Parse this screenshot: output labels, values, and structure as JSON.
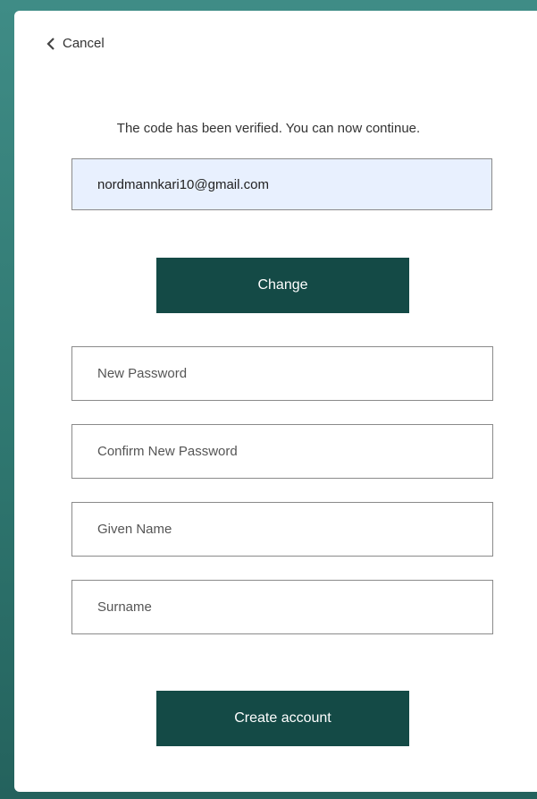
{
  "nav": {
    "cancel_label": "Cancel",
    "cancel_icon": "chevron-left-icon"
  },
  "verification": {
    "message": "The code has been verified. You can now continue.",
    "email_value": "nordmannkari10@gmail.com",
    "change_label": "Change"
  },
  "form": {
    "new_password_placeholder": "New Password",
    "confirm_password_placeholder": "Confirm New Password",
    "given_name_placeholder": "Given Name",
    "surname_placeholder": "Surname",
    "create_label": "Create account"
  },
  "colors": {
    "button_bg": "#144a46",
    "frame_teal": "#2f7770",
    "email_field_bg": "#e8f0fe"
  }
}
